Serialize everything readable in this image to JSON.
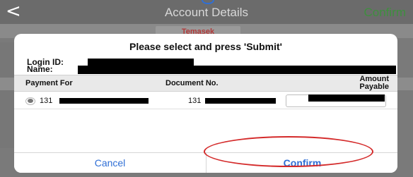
{
  "navbar": {
    "back_glyph": "<",
    "title": "Account Details",
    "confirm_label": "Confirm"
  },
  "background": {
    "logo_text": "Temasek"
  },
  "modal": {
    "title": "Please select and press 'Submit'",
    "login_label": "Login ID:",
    "name_label": "Name:",
    "table": {
      "columns": [
        "Payment For",
        "Document No.",
        "Amount Payable"
      ],
      "amount_header_line1": "Amount",
      "amount_header_line2": "Payable",
      "rows": [
        {
          "payment_for": "131",
          "document_no": "131"
        }
      ]
    },
    "buttons": {
      "cancel": "Cancel",
      "confirm": "Confirm"
    }
  },
  "colors": {
    "nav_confirm": "#3e8f3e",
    "button_text": "#2f6fd6",
    "annotation": "#d42a2a"
  },
  "icons": {
    "back": "chevron-left-icon",
    "radio": "radio-selected-icon"
  }
}
